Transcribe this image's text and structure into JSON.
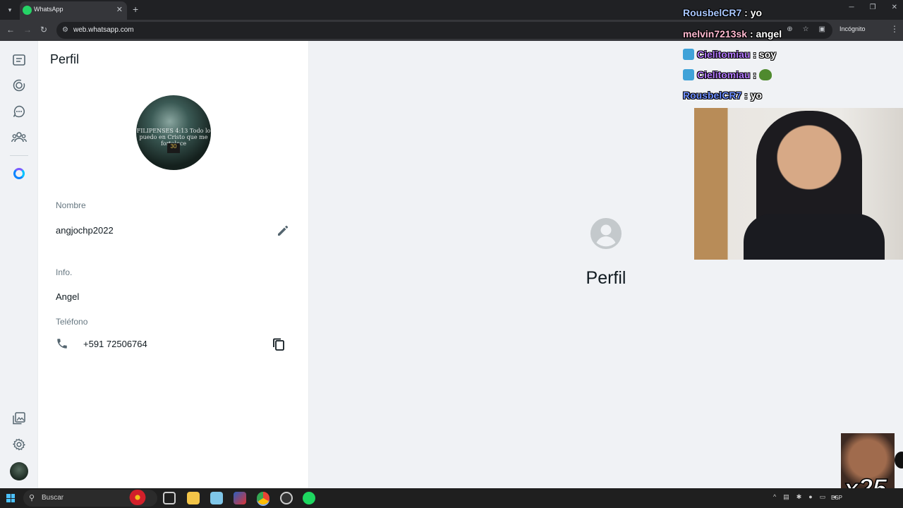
{
  "browser": {
    "tab_title": "WhatsApp",
    "url": "web.whatsapp.com",
    "incognito_label": "Incógnito"
  },
  "panel": {
    "title": "Perfil",
    "photo_text": "FILIPENSES 4:13\nTodo lo puedo en Cristo que me fortalece",
    "photo_jersey": "30",
    "name_label": "Nombre",
    "name_value": "angjochp2022",
    "info_label": "Info.",
    "info_value": "Angel",
    "phone_label": "Teléfono",
    "phone_value": "+591 72506764"
  },
  "main": {
    "title": "Perfil"
  },
  "chat": [
    {
      "user": "RousbelCR7",
      "message": "yo",
      "color": "#a9c7ff"
    },
    {
      "user": "melvin7213sk",
      "message": "angel",
      "color": "#ffb9d0"
    },
    {
      "user": "Cielitomiau",
      "message": "soy",
      "color": "#b57bff"
    },
    {
      "user": "Cielitomiau",
      "message": "",
      "color": "#b57bff"
    },
    {
      "user": "RousbelCR7",
      "message": "yo",
      "color": "#6f8fff"
    }
  ],
  "overlay": {
    "multiplier": "x25"
  },
  "taskbar": {
    "search_placeholder": "Buscar",
    "language": "ESP"
  }
}
